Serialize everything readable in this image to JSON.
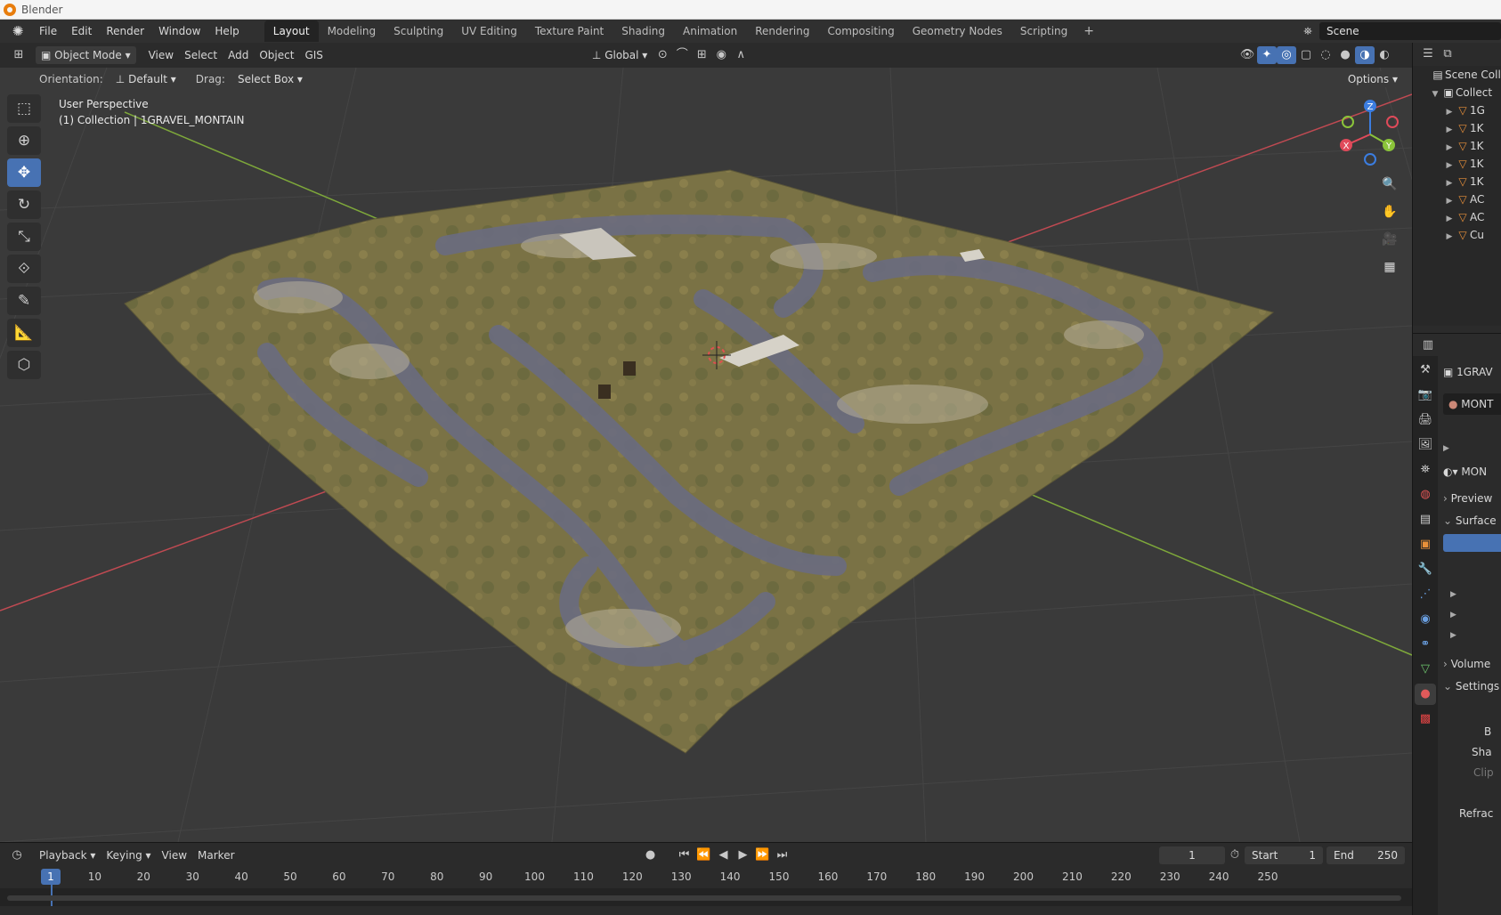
{
  "os": {
    "title": "Blender"
  },
  "menu": [
    "File",
    "Edit",
    "Render",
    "Window",
    "Help"
  ],
  "workspaces": [
    "Layout",
    "Modeling",
    "Sculpting",
    "UV Editing",
    "Texture Paint",
    "Shading",
    "Animation",
    "Rendering",
    "Compositing",
    "Geometry Nodes",
    "Scripting"
  ],
  "workspace_add": "+",
  "active_workspace": "Layout",
  "scene": {
    "name": "Scene"
  },
  "viewport_header": {
    "mode": "Object Mode",
    "menus": [
      "View",
      "Select",
      "Add",
      "Object",
      "GIS"
    ],
    "transform_orientation": "Global"
  },
  "tool_settings": {
    "orientation_label": "Orientation:",
    "orientation_value": "Default",
    "drag_label": "Drag:",
    "drag_value": "Select Box",
    "options_label": "Options"
  },
  "viewport_info": {
    "line1": "User Perspective",
    "line2": "(1) Collection | 1GRAVEL_MONTAIN"
  },
  "gizmo": {
    "z": "Z",
    "x": "X",
    "y": "Y"
  },
  "outliner": {
    "root": "Scene Coll",
    "collection": "Collect",
    "items": [
      "1G",
      "1K",
      "1K",
      "1K",
      "1K",
      "AC",
      "AC",
      "Cu"
    ]
  },
  "properties": {
    "object_name": "1GRAV",
    "material_slot": "MONT",
    "material_name": "MON",
    "sections": [
      "Preview",
      "Surface",
      "Volume",
      "Settings"
    ],
    "settings_rows": [
      "B",
      "Sha",
      "Clip",
      "Refrac"
    ]
  },
  "timeline": {
    "menus": [
      "Playback",
      "Keying",
      "View",
      "Marker"
    ],
    "current_frame": "1",
    "start_label": "Start",
    "start_value": "1",
    "end_label": "End",
    "end_value": "250",
    "ruler_ticks": [
      "10",
      "20",
      "30",
      "40",
      "50",
      "60",
      "70",
      "80",
      "90",
      "100",
      "110",
      "120",
      "130",
      "140",
      "150",
      "160",
      "170",
      "180",
      "190",
      "200",
      "210",
      "220",
      "230",
      "240",
      "250"
    ]
  },
  "colors": {
    "accent": "#4772b3",
    "axis_x": "#e04a5a",
    "axis_y": "#8bc43a",
    "axis_z": "#3b7de0",
    "terrain_grass": "#7a7245",
    "terrain_track": "#6a6c80"
  }
}
